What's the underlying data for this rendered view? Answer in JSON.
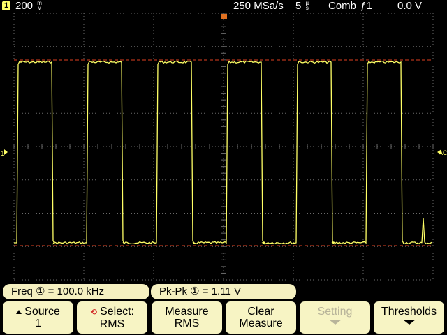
{
  "top_bar": {
    "channel_number": "1",
    "vertical_scale_value": "200",
    "vertical_scale_unit_top": "m",
    "vertical_scale_unit_bottom": "V",
    "sample_rate": "250 MSa/s",
    "timebase_value": "5",
    "timebase_unit_top": "µ",
    "timebase_unit_bottom": "s",
    "acquisition_mode": "Comb",
    "trigger_channel": "1",
    "trigger_level": "0.0 V"
  },
  "markers": {
    "ground_marker": "1",
    "trigger_marker": "AC"
  },
  "measurements": {
    "freq": "Freq ① = 100.0 kHz",
    "pkpk": "Pk-Pk ① =  1.11 V"
  },
  "softkeys": [
    {
      "line1": "Source",
      "line2": "1"
    },
    {
      "line1": "Select:",
      "line2": "RMS"
    },
    {
      "line1": "Measure",
      "line2": "RMS"
    },
    {
      "line1": "Clear",
      "line2": "Measure"
    },
    {
      "line1": "Setting",
      "line2": ""
    },
    {
      "line1": "Thresholds",
      "line2": ""
    }
  ],
  "colors": {
    "trace": "#ffff66",
    "grid": "#6a6a6a",
    "cursor": "#e04020",
    "softkey_bg": "#f7f4c4"
  }
}
